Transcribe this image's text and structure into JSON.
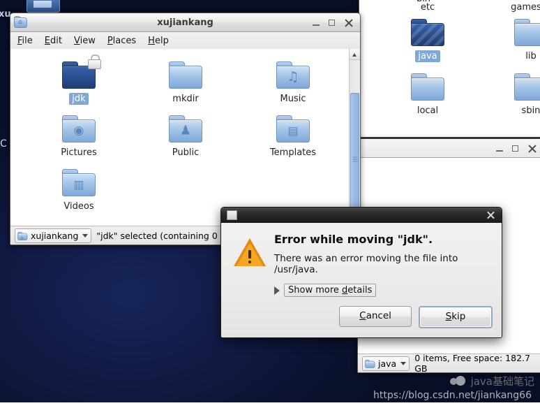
{
  "desktop": {
    "partial_label_left": "xu",
    "partial_label_c": "C",
    "background_color": "#0c1433"
  },
  "back_window_usr": {
    "title": "",
    "items": [
      {
        "name": "bin",
        "selected": false,
        "style": "plain"
      },
      {
        "name": "etc",
        "selected": false,
        "style": "plain"
      },
      {
        "name": "games",
        "selected": false,
        "style": "plain"
      },
      {
        "name": "java",
        "selected": true,
        "style": "drop-target"
      },
      {
        "name": "lib",
        "selected": false,
        "style": "plain"
      },
      {
        "name": "local",
        "selected": false,
        "style": "plain"
      },
      {
        "name": "sbin",
        "selected": false,
        "style": "plain"
      }
    ],
    "statusbar": {
      "path_label": "java",
      "info": "0 items, Free space: 182.7 GB"
    },
    "controls": {
      "minimize": "minimize-icon",
      "maximize": "maximize-icon",
      "close": "close-icon"
    }
  },
  "home_window": {
    "title": "xujiankang",
    "icon": "home-folder-icon",
    "menu": [
      {
        "label": "File",
        "accel": "F"
      },
      {
        "label": "Edit",
        "accel": "E"
      },
      {
        "label": "View",
        "accel": "V"
      },
      {
        "label": "Places",
        "accel": "P"
      },
      {
        "label": "Help",
        "accel": "H"
      }
    ],
    "controls": {
      "minimize": "minimize-icon",
      "maximize": "maximize-icon",
      "close": "close-icon"
    },
    "items": [
      {
        "name": "jdk",
        "glyph": "",
        "selected": true,
        "locked": true,
        "style": "dark"
      },
      {
        "name": "mkdir",
        "glyph": "",
        "selected": false,
        "locked": false,
        "style": "plain"
      },
      {
        "name": "Music",
        "glyph": "♫",
        "selected": false,
        "locked": false,
        "style": "plain"
      },
      {
        "name": "Pictures",
        "glyph": "◉",
        "selected": false,
        "locked": false,
        "style": "plain"
      },
      {
        "name": "Public",
        "glyph": "♟",
        "selected": false,
        "locked": false,
        "style": "plain"
      },
      {
        "name": "Templates",
        "glyph": "▤",
        "selected": false,
        "locked": false,
        "style": "plain"
      },
      {
        "name": "Videos",
        "glyph": "▥",
        "selected": false,
        "locked": false,
        "style": "plain"
      }
    ],
    "statusbar": {
      "path_label": "xujiankang",
      "info": "\"jdk\" selected (containing 0"
    }
  },
  "error_dialog": {
    "titlebar_icon": "window-icon",
    "close_label": "close-icon",
    "warning_icon": "warning-triangle-icon",
    "heading": "Error while moving \"jdk\".",
    "message": "There was an error moving the file into /usr/java.",
    "details_toggle": "Show more details",
    "details_toggle_prefix": "Show more ",
    "details_toggle_accel": "d",
    "details_toggle_suffix": "etails",
    "buttons": [
      {
        "label": "Cancel",
        "accel": "C",
        "default": false
      },
      {
        "label": "Skip",
        "accel": "S",
        "default": true
      }
    ]
  },
  "watermark": {
    "logo": "wechat-logo-icon",
    "text": "java基础笔记",
    "url": "https://blog.csdn.net/jiankang66"
  }
}
